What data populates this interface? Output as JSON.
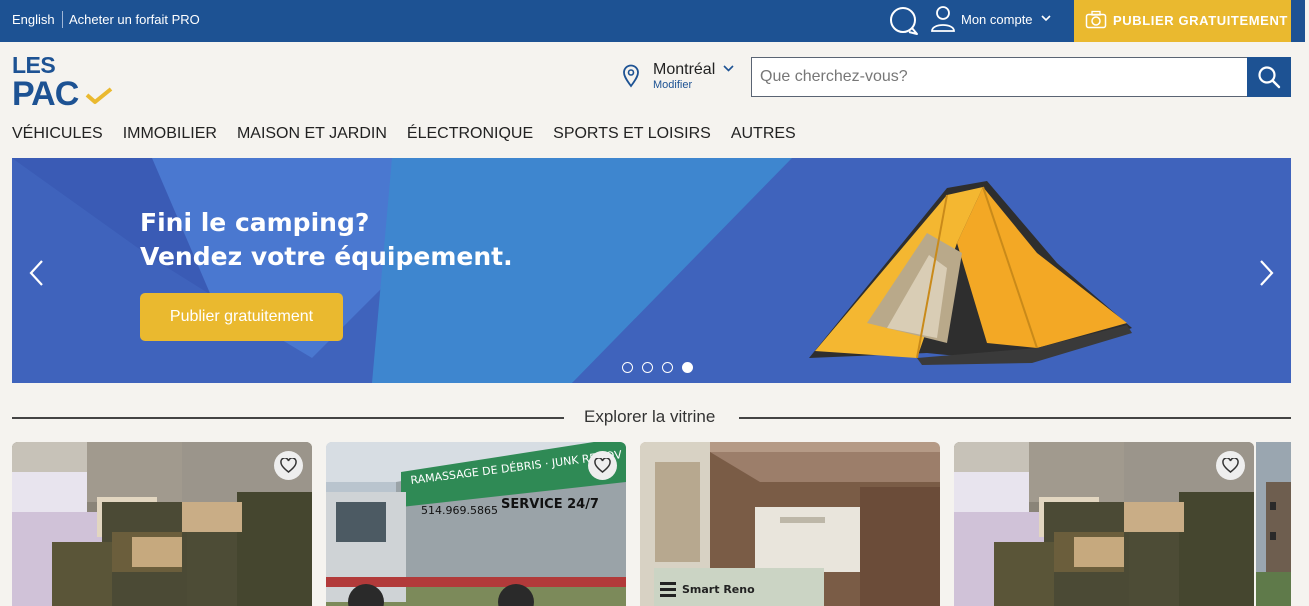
{
  "topbar": {
    "language": "English",
    "pro_plan": "Acheter un forfait PRO",
    "account": "Mon compte",
    "publish": "PUBLIER GRATUITEMENT",
    "icons": [
      "chat-icon",
      "user-icon",
      "chevron-down-icon",
      "camera-icon"
    ]
  },
  "header": {
    "logo_line1": "LES",
    "logo_line2": "PAC",
    "location": "Montréal",
    "location_modify": "Modifier",
    "search_placeholder": "Que cherchez-vous?"
  },
  "nav": [
    "VÉHICULES",
    "IMMOBILIER",
    "MAISON ET JARDIN",
    "ÉLECTRONIQUE",
    "SPORTS ET LOISIRS",
    "AUTRES"
  ],
  "hero": {
    "title_line1": "Fini le camping?",
    "title_line2": "Vendez votre équipement.",
    "cta": "Publier gratuitement",
    "slides": 4,
    "active_slide": 4
  },
  "showcase": {
    "title": "Explorer la vitrine",
    "cards": [
      {
        "image": "stacked-flooring-boxes"
      },
      {
        "image": "junk-removal-truck",
        "truck_text_1": "RAMASSAGE DE DÉBRIS · JUNK REMOV",
        "truck_text_2": "514.969.5865",
        "truck_text_3": "SERVICE 24/7"
      },
      {
        "image": "renovation-interior",
        "badge": "Smart Reno"
      },
      {
        "image": "stacked-flooring-boxes"
      }
    ]
  },
  "colors": {
    "brand_blue": "#1d5293",
    "accent_yellow": "#eab92f",
    "hero_blue": "#3f63bc"
  }
}
